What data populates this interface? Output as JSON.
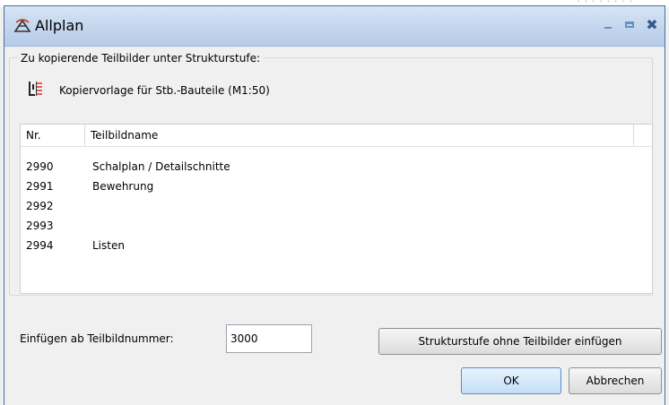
{
  "window": {
    "title": "Allplan",
    "controls": {
      "minimize_icon": "minimize-icon",
      "maximize_icon": "maximize-icon",
      "close_symbol": "✖"
    }
  },
  "group": {
    "label": "Zu kopierende Teilbilder unter Strukturstufe:",
    "template_icon": "structure-template-icon",
    "template_label": "Kopiervorlage für Stb.-Bauteile (M1:50)"
  },
  "table": {
    "columns": [
      "Nr.",
      "Teilbildname"
    ],
    "rows": [
      {
        "nr": "2990",
        "name": "Schalplan / Detailschnitte"
      },
      {
        "nr": "2991",
        "name": "Bewehrung"
      },
      {
        "nr": "2992",
        "name": ""
      },
      {
        "nr": "2993",
        "name": ""
      },
      {
        "nr": "2994",
        "name": "Listen"
      }
    ]
  },
  "insert": {
    "label": "Einfügen ab Teilbildnummer:",
    "value": "3000"
  },
  "buttons": {
    "strukturstufe": "Strukturstufe ohne Teilbilder einfügen",
    "ok": "OK",
    "cancel": "Abbrechen"
  },
  "colors": {
    "titlebar": "#c4d6ed",
    "window_border": "#4a6f9e",
    "ok_accent": "#c4def6"
  }
}
